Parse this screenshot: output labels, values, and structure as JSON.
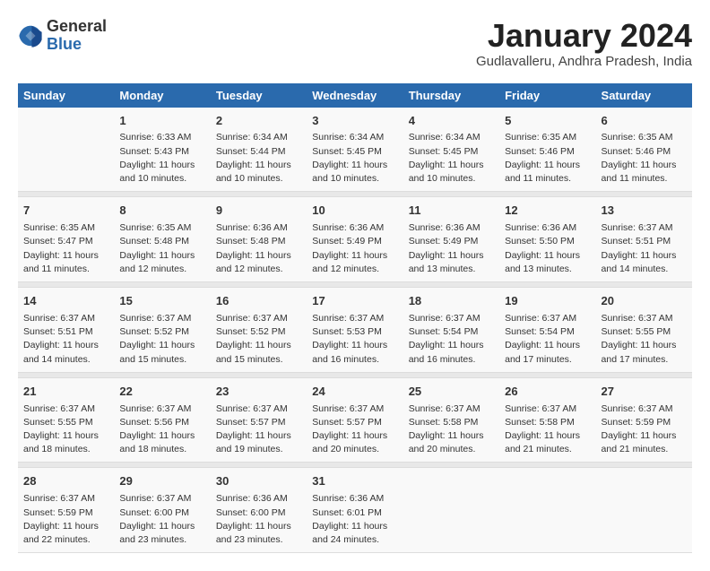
{
  "header": {
    "logo_general": "General",
    "logo_blue": "Blue",
    "month_title": "January 2024",
    "location": "Gudlavalleru, Andhra Pradesh, India"
  },
  "days_of_week": [
    "Sunday",
    "Monday",
    "Tuesday",
    "Wednesday",
    "Thursday",
    "Friday",
    "Saturday"
  ],
  "weeks": [
    [
      {
        "day": "",
        "info": ""
      },
      {
        "day": "1",
        "info": "Sunrise: 6:33 AM\nSunset: 5:43 PM\nDaylight: 11 hours\nand 10 minutes."
      },
      {
        "day": "2",
        "info": "Sunrise: 6:34 AM\nSunset: 5:44 PM\nDaylight: 11 hours\nand 10 minutes."
      },
      {
        "day": "3",
        "info": "Sunrise: 6:34 AM\nSunset: 5:45 PM\nDaylight: 11 hours\nand 10 minutes."
      },
      {
        "day": "4",
        "info": "Sunrise: 6:34 AM\nSunset: 5:45 PM\nDaylight: 11 hours\nand 10 minutes."
      },
      {
        "day": "5",
        "info": "Sunrise: 6:35 AM\nSunset: 5:46 PM\nDaylight: 11 hours\nand 11 minutes."
      },
      {
        "day": "6",
        "info": "Sunrise: 6:35 AM\nSunset: 5:46 PM\nDaylight: 11 hours\nand 11 minutes."
      }
    ],
    [
      {
        "day": "7",
        "info": "Sunrise: 6:35 AM\nSunset: 5:47 PM\nDaylight: 11 hours\nand 11 minutes."
      },
      {
        "day": "8",
        "info": "Sunrise: 6:35 AM\nSunset: 5:48 PM\nDaylight: 11 hours\nand 12 minutes."
      },
      {
        "day": "9",
        "info": "Sunrise: 6:36 AM\nSunset: 5:48 PM\nDaylight: 11 hours\nand 12 minutes."
      },
      {
        "day": "10",
        "info": "Sunrise: 6:36 AM\nSunset: 5:49 PM\nDaylight: 11 hours\nand 12 minutes."
      },
      {
        "day": "11",
        "info": "Sunrise: 6:36 AM\nSunset: 5:49 PM\nDaylight: 11 hours\nand 13 minutes."
      },
      {
        "day": "12",
        "info": "Sunrise: 6:36 AM\nSunset: 5:50 PM\nDaylight: 11 hours\nand 13 minutes."
      },
      {
        "day": "13",
        "info": "Sunrise: 6:37 AM\nSunset: 5:51 PM\nDaylight: 11 hours\nand 14 minutes."
      }
    ],
    [
      {
        "day": "14",
        "info": "Sunrise: 6:37 AM\nSunset: 5:51 PM\nDaylight: 11 hours\nand 14 minutes."
      },
      {
        "day": "15",
        "info": "Sunrise: 6:37 AM\nSunset: 5:52 PM\nDaylight: 11 hours\nand 15 minutes."
      },
      {
        "day": "16",
        "info": "Sunrise: 6:37 AM\nSunset: 5:52 PM\nDaylight: 11 hours\nand 15 minutes."
      },
      {
        "day": "17",
        "info": "Sunrise: 6:37 AM\nSunset: 5:53 PM\nDaylight: 11 hours\nand 16 minutes."
      },
      {
        "day": "18",
        "info": "Sunrise: 6:37 AM\nSunset: 5:54 PM\nDaylight: 11 hours\nand 16 minutes."
      },
      {
        "day": "19",
        "info": "Sunrise: 6:37 AM\nSunset: 5:54 PM\nDaylight: 11 hours\nand 17 minutes."
      },
      {
        "day": "20",
        "info": "Sunrise: 6:37 AM\nSunset: 5:55 PM\nDaylight: 11 hours\nand 17 minutes."
      }
    ],
    [
      {
        "day": "21",
        "info": "Sunrise: 6:37 AM\nSunset: 5:55 PM\nDaylight: 11 hours\nand 18 minutes."
      },
      {
        "day": "22",
        "info": "Sunrise: 6:37 AM\nSunset: 5:56 PM\nDaylight: 11 hours\nand 18 minutes."
      },
      {
        "day": "23",
        "info": "Sunrise: 6:37 AM\nSunset: 5:57 PM\nDaylight: 11 hours\nand 19 minutes."
      },
      {
        "day": "24",
        "info": "Sunrise: 6:37 AM\nSunset: 5:57 PM\nDaylight: 11 hours\nand 20 minutes."
      },
      {
        "day": "25",
        "info": "Sunrise: 6:37 AM\nSunset: 5:58 PM\nDaylight: 11 hours\nand 20 minutes."
      },
      {
        "day": "26",
        "info": "Sunrise: 6:37 AM\nSunset: 5:58 PM\nDaylight: 11 hours\nand 21 minutes."
      },
      {
        "day": "27",
        "info": "Sunrise: 6:37 AM\nSunset: 5:59 PM\nDaylight: 11 hours\nand 21 minutes."
      }
    ],
    [
      {
        "day": "28",
        "info": "Sunrise: 6:37 AM\nSunset: 5:59 PM\nDaylight: 11 hours\nand 22 minutes."
      },
      {
        "day": "29",
        "info": "Sunrise: 6:37 AM\nSunset: 6:00 PM\nDaylight: 11 hours\nand 23 minutes."
      },
      {
        "day": "30",
        "info": "Sunrise: 6:36 AM\nSunset: 6:00 PM\nDaylight: 11 hours\nand 23 minutes."
      },
      {
        "day": "31",
        "info": "Sunrise: 6:36 AM\nSunset: 6:01 PM\nDaylight: 11 hours\nand 24 minutes."
      },
      {
        "day": "",
        "info": ""
      },
      {
        "day": "",
        "info": ""
      },
      {
        "day": "",
        "info": ""
      }
    ]
  ]
}
